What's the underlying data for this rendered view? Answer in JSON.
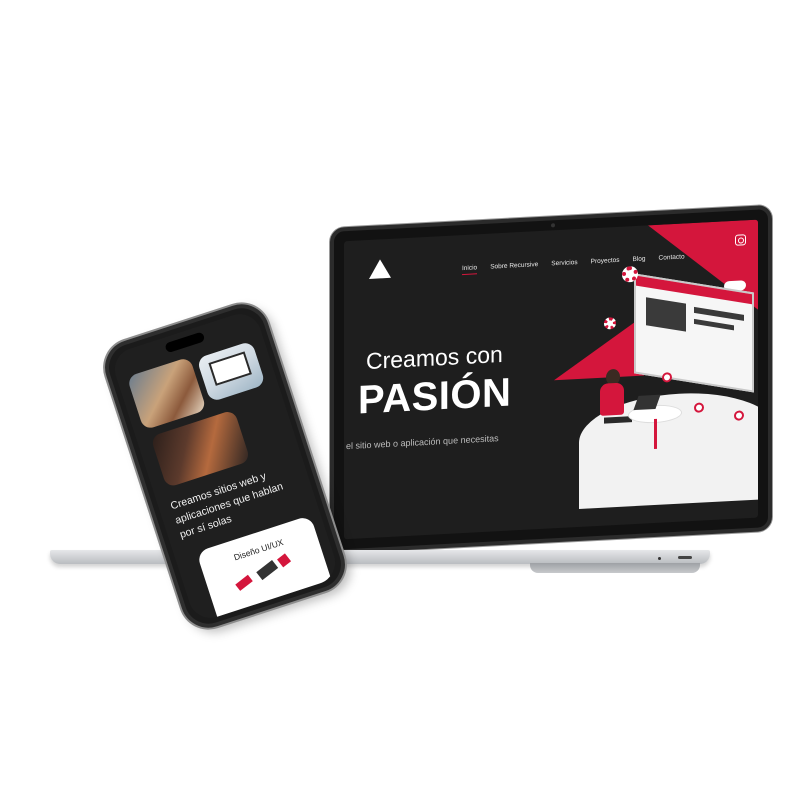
{
  "laptop": {
    "nav": {
      "items": [
        "Inicio",
        "Sobre Recursive",
        "Servicios",
        "Proyectos",
        "Blog",
        "Contacto"
      ],
      "active_index": 0,
      "social_icon": "instagram-icon"
    },
    "hero": {
      "title_line_1": "Creamos con",
      "title_line_2": "PASIÓN",
      "subtitle": "el sitio web o aplicación que necesitas"
    }
  },
  "phone": {
    "headline": "Creamos sitios web y aplicaciones que hablan por sí solas",
    "card": {
      "title": "Diseño UI/UX"
    }
  },
  "colors": {
    "accent": "#d4163c",
    "background_dark": "#1e1e1e",
    "text_light": "#ffffff"
  }
}
